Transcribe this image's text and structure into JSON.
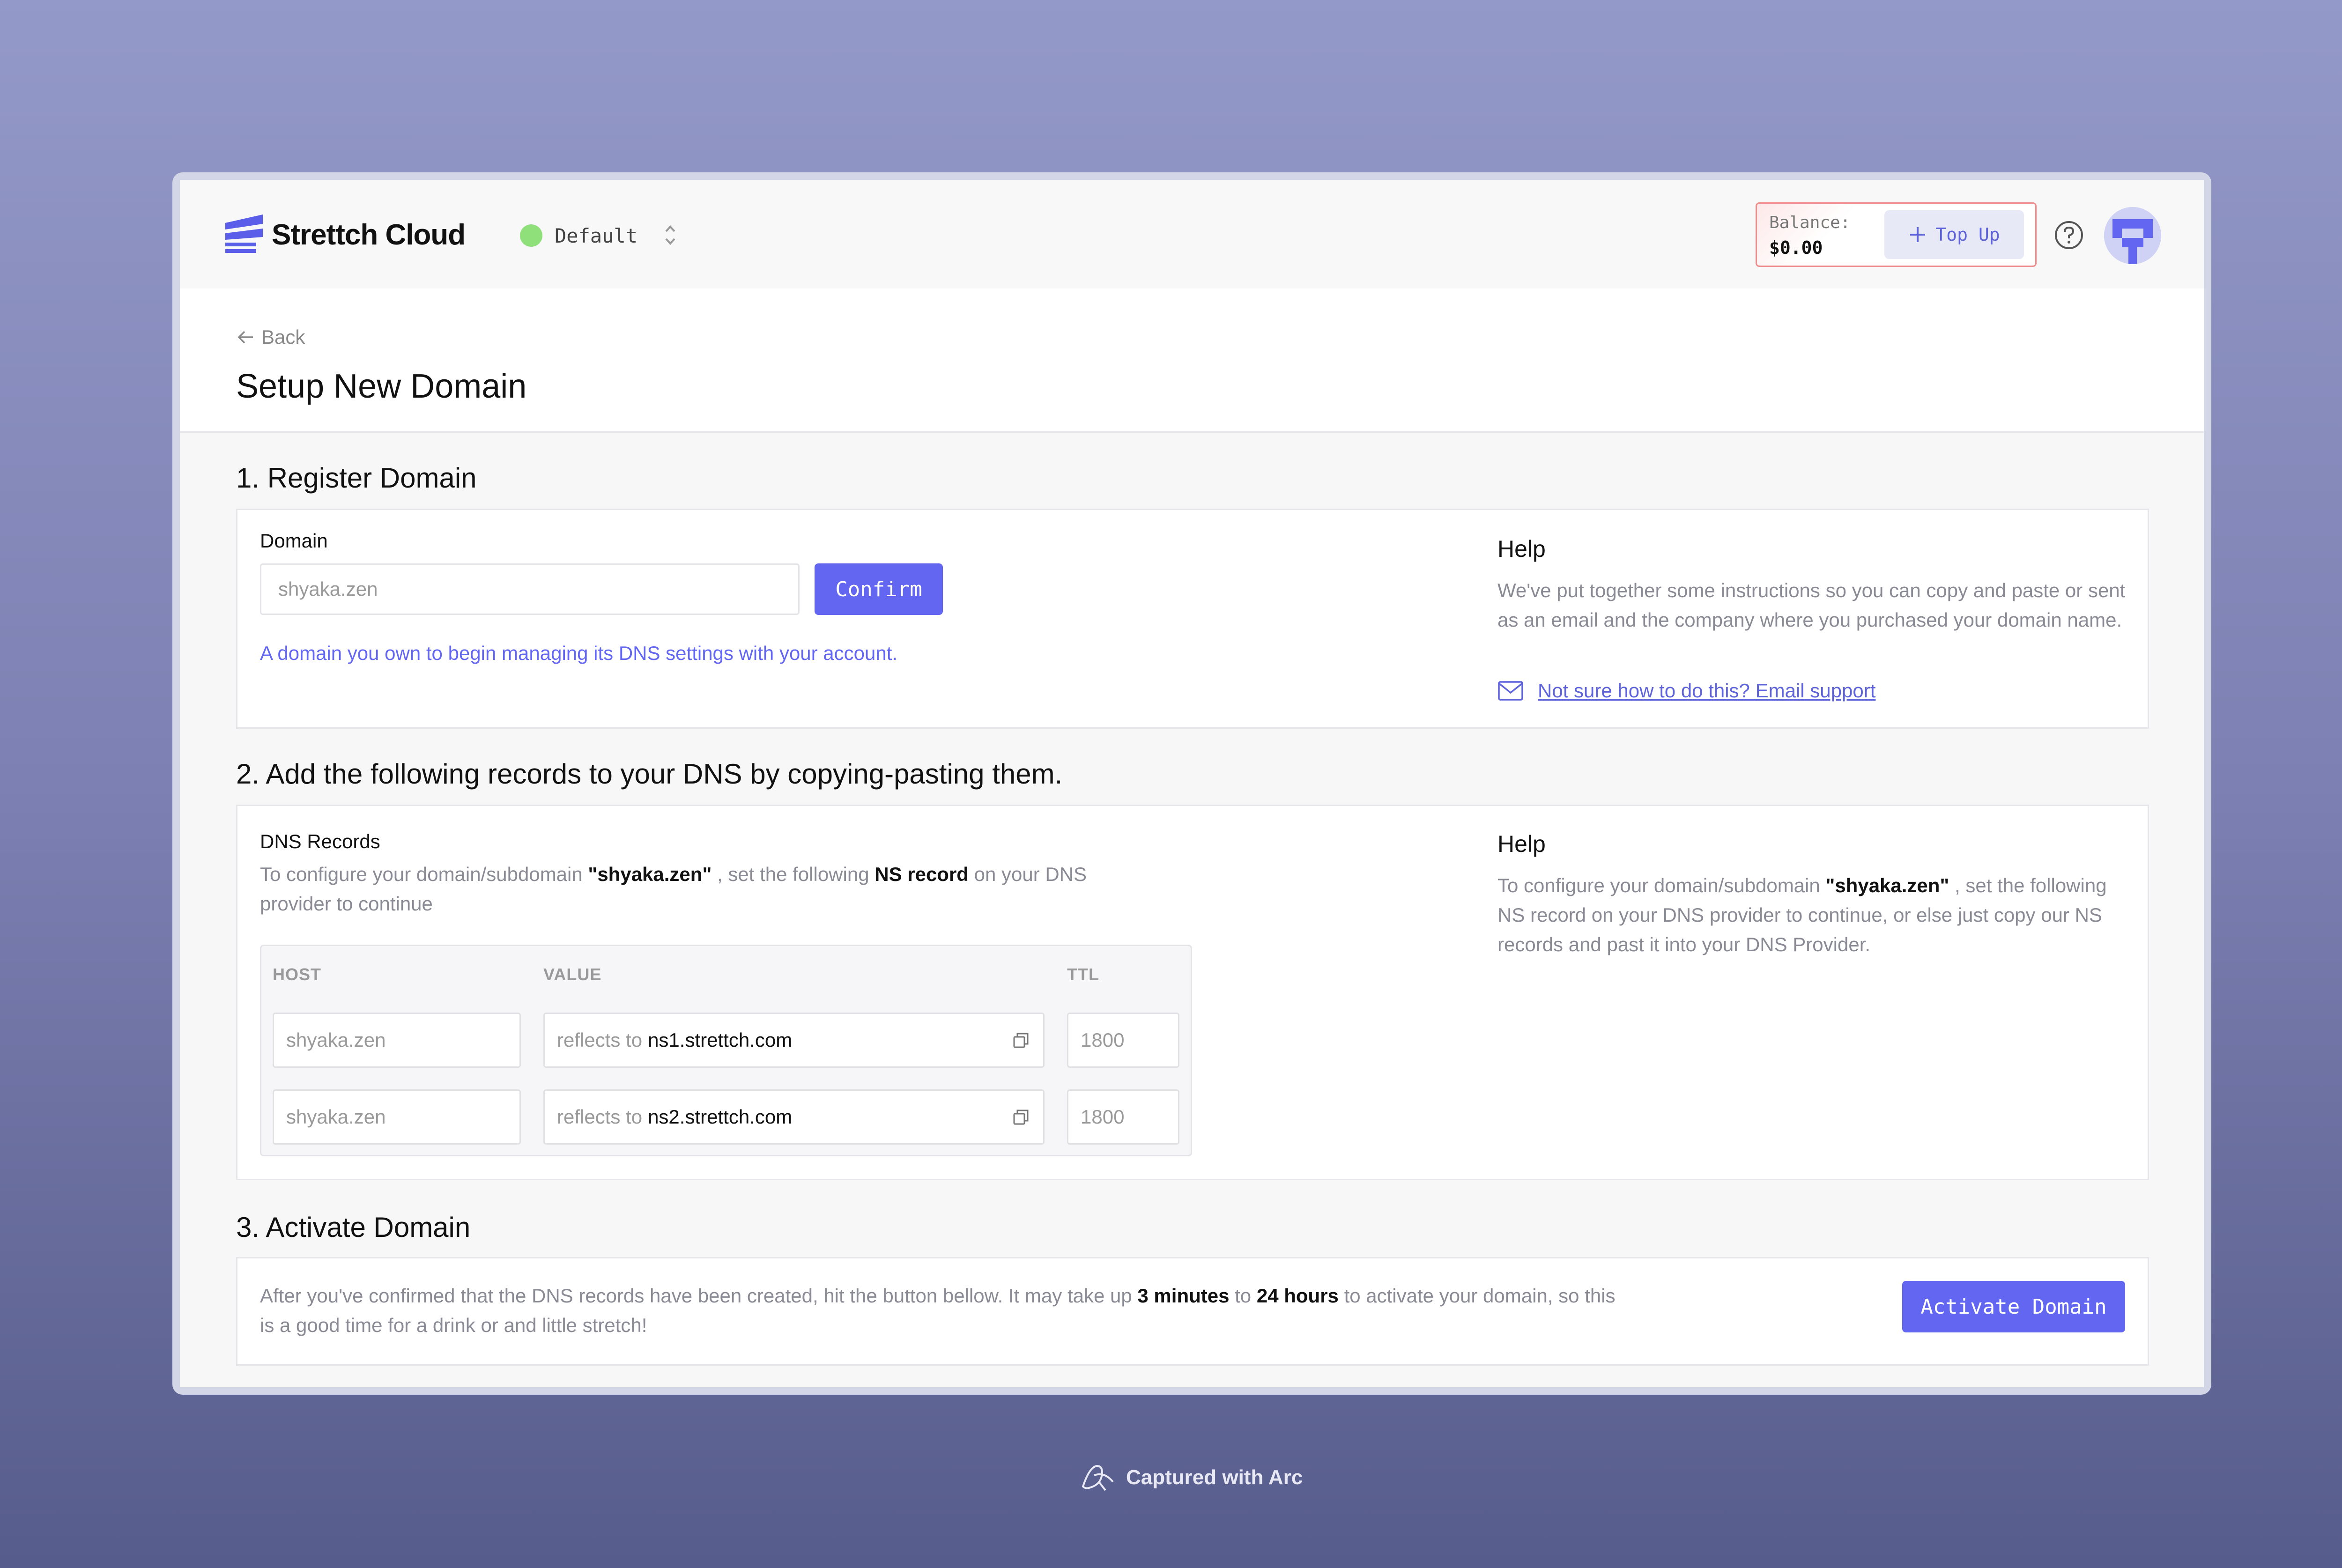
{
  "header": {
    "brand": "Strettch Cloud",
    "workspace": "Default",
    "balance_label": "Balance:",
    "balance_value": "$0.00",
    "topup_label": "Top Up",
    "status_color": "#8fe07a",
    "accent_color": "#6366f1"
  },
  "page": {
    "back_label": "Back",
    "title": "Setup New Domain"
  },
  "register": {
    "heading": "1. Register Domain",
    "field_label": "Domain",
    "domain_placeholder": "shyaka.zen",
    "confirm_label": "Confirm",
    "hint": "A domain you own to begin managing its DNS settings with your account.",
    "help_title": "Help",
    "help_text": "We've put together some instructions so you can copy and paste or sent as an email and the company where you purchased your domain name.",
    "email_link": "Not sure how to do this? Email support"
  },
  "dns": {
    "heading": "2. Add the following records to your DNS by copying-pasting them.",
    "title": "DNS Records",
    "desc_1": "To configure your domain/subdomain",
    "desc_domain": "\"shyaka.zen\"",
    "desc_2": ", set the following",
    "desc_record": "NS record",
    "desc_3": "on your DNS",
    "desc_4": "provider to continue",
    "columns": {
      "host": "HOST",
      "value": "VALUE",
      "ttl": "TTL"
    },
    "reflects_label": "reflects to",
    "rows": [
      {
        "host": "shyaka.zen",
        "value": "ns1.strettch.com",
        "ttl": "1800"
      },
      {
        "host": "shyaka.zen",
        "value": "ns2.strettch.com",
        "ttl": "1800"
      }
    ],
    "help_title": "Help",
    "help_1": "To configure your domain/subdomain",
    "help_domain": "\"shyaka.zen\"",
    "help_2": ", set the following NS record on your DNS provider to continue, or else just copy our NS records and past it into your DNS Provider."
  },
  "activate": {
    "heading": "3. Activate Domain",
    "text_1": "After you've confirmed that the DNS records have been created, hit the button bellow. It may take up",
    "min": "3 minutes",
    "to": "to",
    "max": "24 hours",
    "text_2": "to activate your domain, so this is a good time for a drink or and little stretch!",
    "button_label": "Activate Domain"
  },
  "footer": {
    "label": "Captured with Arc"
  }
}
